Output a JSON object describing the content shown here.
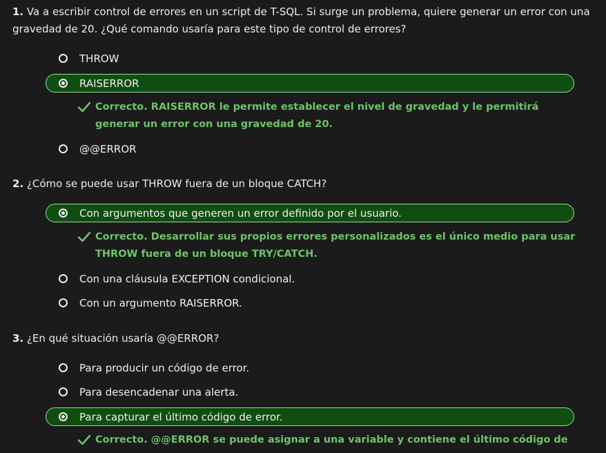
{
  "questions": [
    {
      "number": "1.",
      "text": "Va a escribir control de errores en un script de T-SQL. Si surge un problema, quiere generar un error con una gravedad de 20. ¿Qué comando usaría para este tipo de control de errores?",
      "options": [
        {
          "label": "THROW",
          "selected": false
        },
        {
          "label": "RAISERROR",
          "selected": true
        },
        {
          "label": "@@ERROR",
          "selected": false
        }
      ],
      "feedback": "Correcto. RAISERROR le permite establecer el nivel de gravedad y le permitirá generar un error con una gravedad de 20."
    },
    {
      "number": "2.",
      "text": "¿Cómo se puede usar THROW fuera de un bloque CATCH?",
      "options": [
        {
          "label": "Con argumentos que generen un error definido por el usuario.",
          "selected": true
        },
        {
          "label": "Con una cláusula EXCEPTION condicional.",
          "selected": false
        },
        {
          "label": "Con un argumento RAISERROR.",
          "selected": false
        }
      ],
      "feedback": "Correcto. Desarrollar sus propios errores personalizados es el único medio para usar THROW fuera de un bloque TRY/CATCH."
    },
    {
      "number": "3.",
      "text": "¿En qué situación usaría @@ERROR?",
      "options": [
        {
          "label": "Para producir un código de error.",
          "selected": false
        },
        {
          "label": "Para desencadenar una alerta.",
          "selected": false
        },
        {
          "label": "Para capturar el último código de error.",
          "selected": true
        }
      ],
      "feedback": "Correcto. @@ERROR se puede asignar a una variable y contiene el último código de error."
    }
  ],
  "colors": {
    "background": "#1b1b1b",
    "selected_fill": "#104d10",
    "selected_border": "#9fd89f",
    "feedback_text": "#6ec36a"
  },
  "icons": {
    "radio": "radio-icon",
    "check": "check-icon"
  }
}
